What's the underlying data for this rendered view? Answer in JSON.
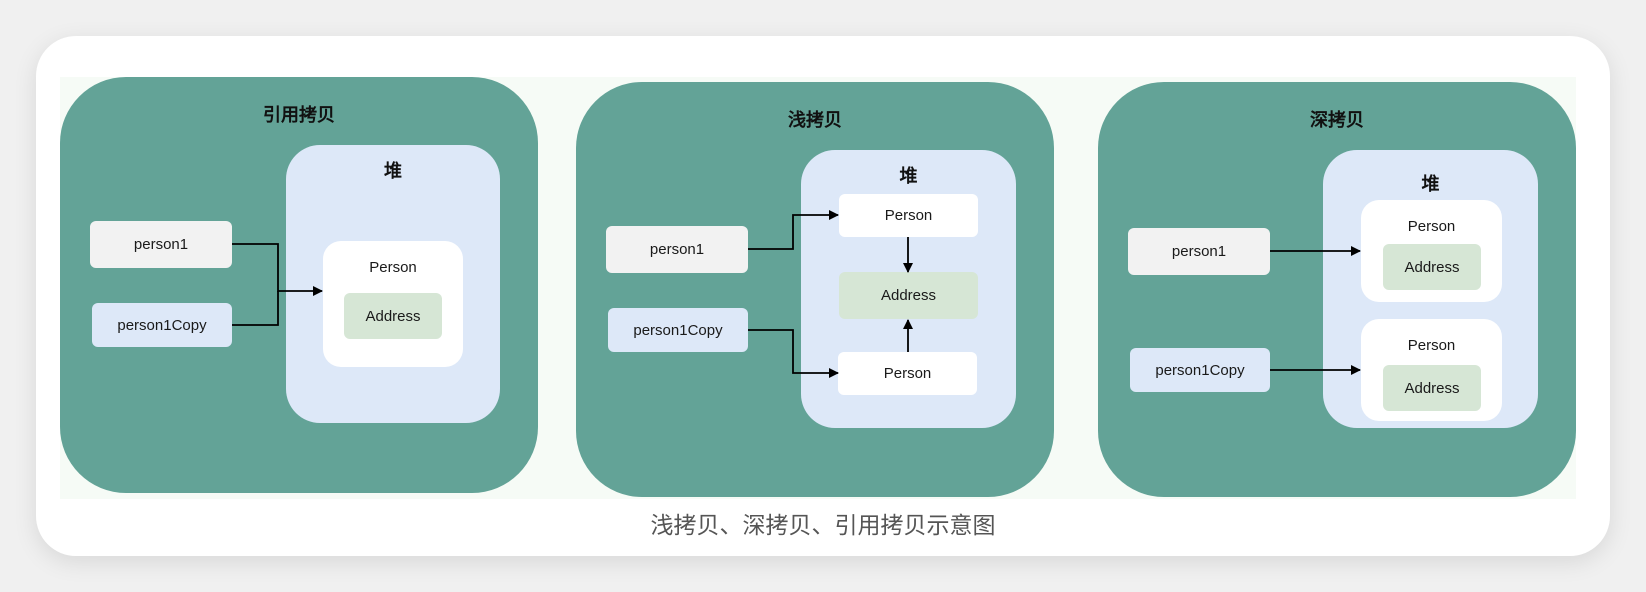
{
  "panels": {
    "reference": {
      "title": "引用拷贝",
      "heap_title": "堆",
      "var1": "person1",
      "var2": "person1Copy",
      "person": "Person",
      "address": "Address"
    },
    "shallow": {
      "title": "浅拷贝",
      "heap_title": "堆",
      "var1": "person1",
      "var2": "person1Copy",
      "person_top": "Person",
      "address": "Address",
      "person_bottom": "Person"
    },
    "deep": {
      "title": "深拷贝",
      "heap_title": "堆",
      "var1": "person1",
      "var2": "person1Copy",
      "person1": "Person",
      "address1": "Address",
      "person2": "Person",
      "address2": "Address"
    }
  },
  "caption": "浅拷贝、深拷贝、引用拷贝示意图",
  "colors": {
    "panel": "#63a397",
    "heap": "#dde8f8",
    "variable_gray": "#f2f2f2",
    "variable_blue": "#dde8f8",
    "address": "#d6e6d5"
  }
}
